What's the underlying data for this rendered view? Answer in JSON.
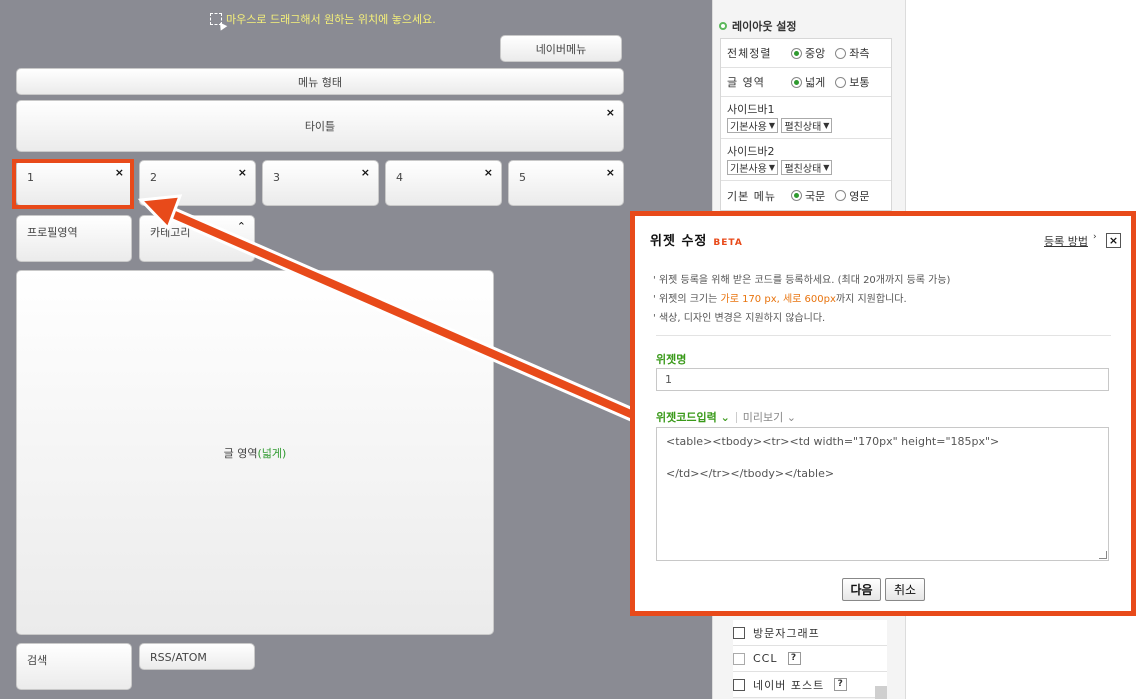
{
  "canvas": {
    "hint": "마우스로 드래그해서 원하는 위치에 놓으세요.",
    "naver_menu": "네이버메뉴",
    "menu_type": "메뉴 형태",
    "title_box": "타이틀",
    "widgets": [
      "1",
      "2",
      "3",
      "4",
      "5"
    ],
    "profile": "프로필영역",
    "category": "카테고리",
    "content": {
      "label": "글 영역",
      "paren": "(넓게)"
    },
    "search": "검색",
    "rss": "RSS/ATOM",
    "close_glyph": "×"
  },
  "panel": {
    "title": "레이아웃 설정",
    "align": {
      "label": "전체정렬",
      "opts": [
        "중앙",
        "좌측"
      ]
    },
    "content_area": {
      "label": "글 영역",
      "opts": [
        "넓게",
        "보통"
      ]
    },
    "sidebar1": {
      "label": "사이드바1",
      "sel1": "기본사용",
      "sel2": "펼친상태"
    },
    "sidebar2": {
      "label": "사이드바2",
      "sel1": "기본사용",
      "sel2": "펼친상태"
    },
    "basic_menu": {
      "label": "기본 메뉴",
      "opts": [
        "국문",
        "영문"
      ]
    },
    "checkbox_items": [
      {
        "label": "방문자그래프",
        "help": ""
      },
      {
        "label": "CCL",
        "help": "?"
      },
      {
        "label": "네이버 포스트",
        "help": "?"
      }
    ]
  },
  "dialog": {
    "title": "위젯 수정",
    "badge": "BETA",
    "howto": "등록 방법",
    "close": "×",
    "note1": "위젯 등록을 위해 받은 코드를 등록하세요. (최대 20개까지 등록 가능)",
    "note2_pre": "위젯의 크기는 ",
    "note2_hl": "가로 170 px, 세로 600px",
    "note2_post": "까지 지원합니다.",
    "note3": "색상, 디자인 변경은 지원하지 않습니다.",
    "name_label": "위젯명",
    "name_value": "1",
    "tab_code": "위젯코드입력",
    "tab_preview": "미리보기",
    "code_line1": "<table><tbody><tr><td width=\"170px\" height=\"185px\">",
    "code_line2": "</td></tr></tbody></table>",
    "btn_next": "다음",
    "btn_cancel": "취소"
  },
  "colors": {
    "accent": "#e84a1a",
    "green": "#3a9a1a",
    "canvas_bg": "#8a8b93"
  }
}
